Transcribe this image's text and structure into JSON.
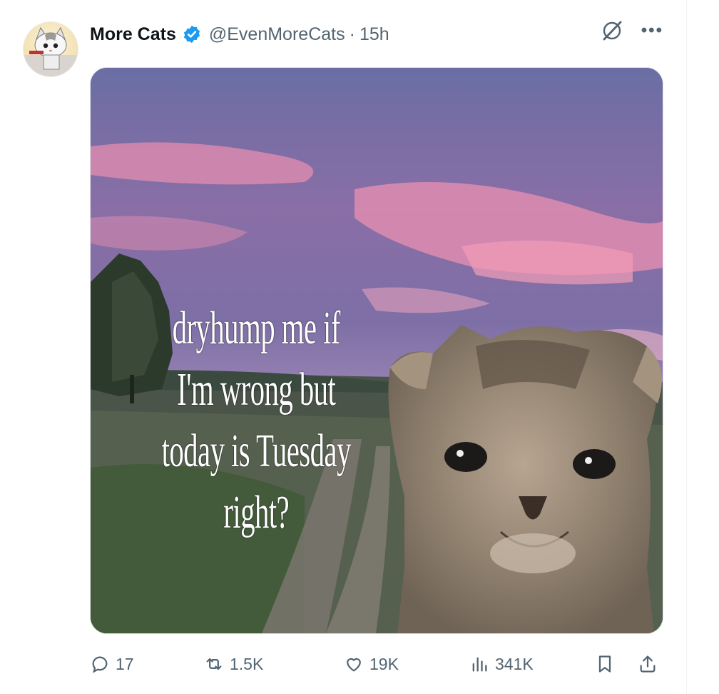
{
  "post": {
    "author_name": "More Cats",
    "handle": "@EvenMoreCats",
    "separator": "·",
    "time": "15h",
    "more_label": "•••",
    "image": {
      "caption_lines": [
        "dryhump me if",
        "I'm wrong but",
        "today is Tuesday",
        "right?"
      ]
    }
  },
  "actions": {
    "replies": "17",
    "reposts": "1.5K",
    "likes": "19K",
    "views": "341K"
  },
  "colors": {
    "text_primary": "#0f1419",
    "text_secondary": "#536471",
    "verified": "#1d9bf0"
  },
  "icons": {
    "verified": "verified-badge-icon",
    "grok": "grok-icon",
    "more": "more-icon",
    "reply": "reply-icon",
    "repost": "repost-icon",
    "like": "heart-icon",
    "views": "views-icon",
    "bookmark": "bookmark-icon",
    "share": "share-icon"
  }
}
